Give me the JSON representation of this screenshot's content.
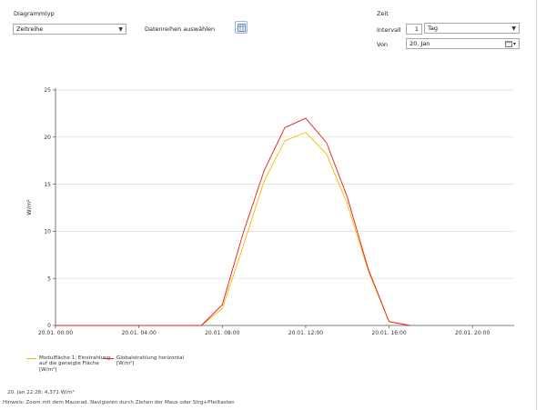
{
  "controls": {
    "chart_type_label": "Diagrammtyp",
    "chart_type_value": "Zeitreihe",
    "select_series_label": "Datenreihen auswählen",
    "time_label": "Zeit",
    "interval_label": "Intervall",
    "interval_count": "1",
    "interval_unit": "Tag",
    "from_label": "Von",
    "from_value": "20. Jan"
  },
  "icons": {
    "series_picker": "table-icon",
    "calendar": "calendar-icon",
    "dropdown": "chevron-down-icon"
  },
  "chart_data": {
    "type": "line",
    "title": "",
    "xlabel": "",
    "ylabel": "W/m²",
    "x": [
      "20.01. 00:00",
      "20.01. 01:00",
      "20.01. 02:00",
      "20.01. 03:00",
      "20.01. 04:00",
      "20.01. 05:00",
      "20.01. 06:00",
      "20.01. 07:00",
      "20.01. 08:00",
      "20.01. 09:00",
      "20.01. 10:00",
      "20.01. 11:00",
      "20.01. 12:00",
      "20.01. 13:00",
      "20.01. 14:00",
      "20.01. 15:00",
      "20.01. 16:00",
      "20.01. 17:00"
    ],
    "xticks": [
      "20.01. 00:00",
      "20.01. 04:00",
      "20.01. 08:00",
      "20.01. 12:00",
      "20.01. 16:00",
      "20.01. 20:00"
    ],
    "xlim_hours": [
      0,
      22
    ],
    "ylim": [
      0,
      25
    ],
    "yticks": [
      0,
      5,
      10,
      15,
      20,
      25
    ],
    "grid": true,
    "legend_position": "bottom-left",
    "series": [
      {
        "name_lines": [
          "Modulfläche 1: Einstrahlung",
          "auf die geneigte Fläche",
          "[W/m²]"
        ],
        "color": "#f5b800",
        "values": [
          0,
          0,
          0,
          0,
          0,
          0,
          0,
          0,
          1.8,
          8.4,
          15.3,
          19.6,
          20.5,
          18.2,
          12.9,
          5.8,
          0.4,
          0
        ]
      },
      {
        "name_lines": [
          "Globalstrahlung horizontal",
          "[W/m²]"
        ],
        "color": "#e8191c",
        "values": [
          0,
          0,
          0,
          0,
          0,
          0,
          0,
          0,
          2.2,
          9.8,
          16.4,
          21.0,
          22.0,
          19.4,
          13.6,
          6.0,
          0.4,
          0
        ]
      }
    ]
  },
  "status": {
    "readout": "20. Jan 22:28: 4,371 W/m²",
    "hint": "Hinweis: Zoom mit dem Mausrad. Navigieren durch Ziehen der Maus oder Strg+Pfeiltasten"
  }
}
